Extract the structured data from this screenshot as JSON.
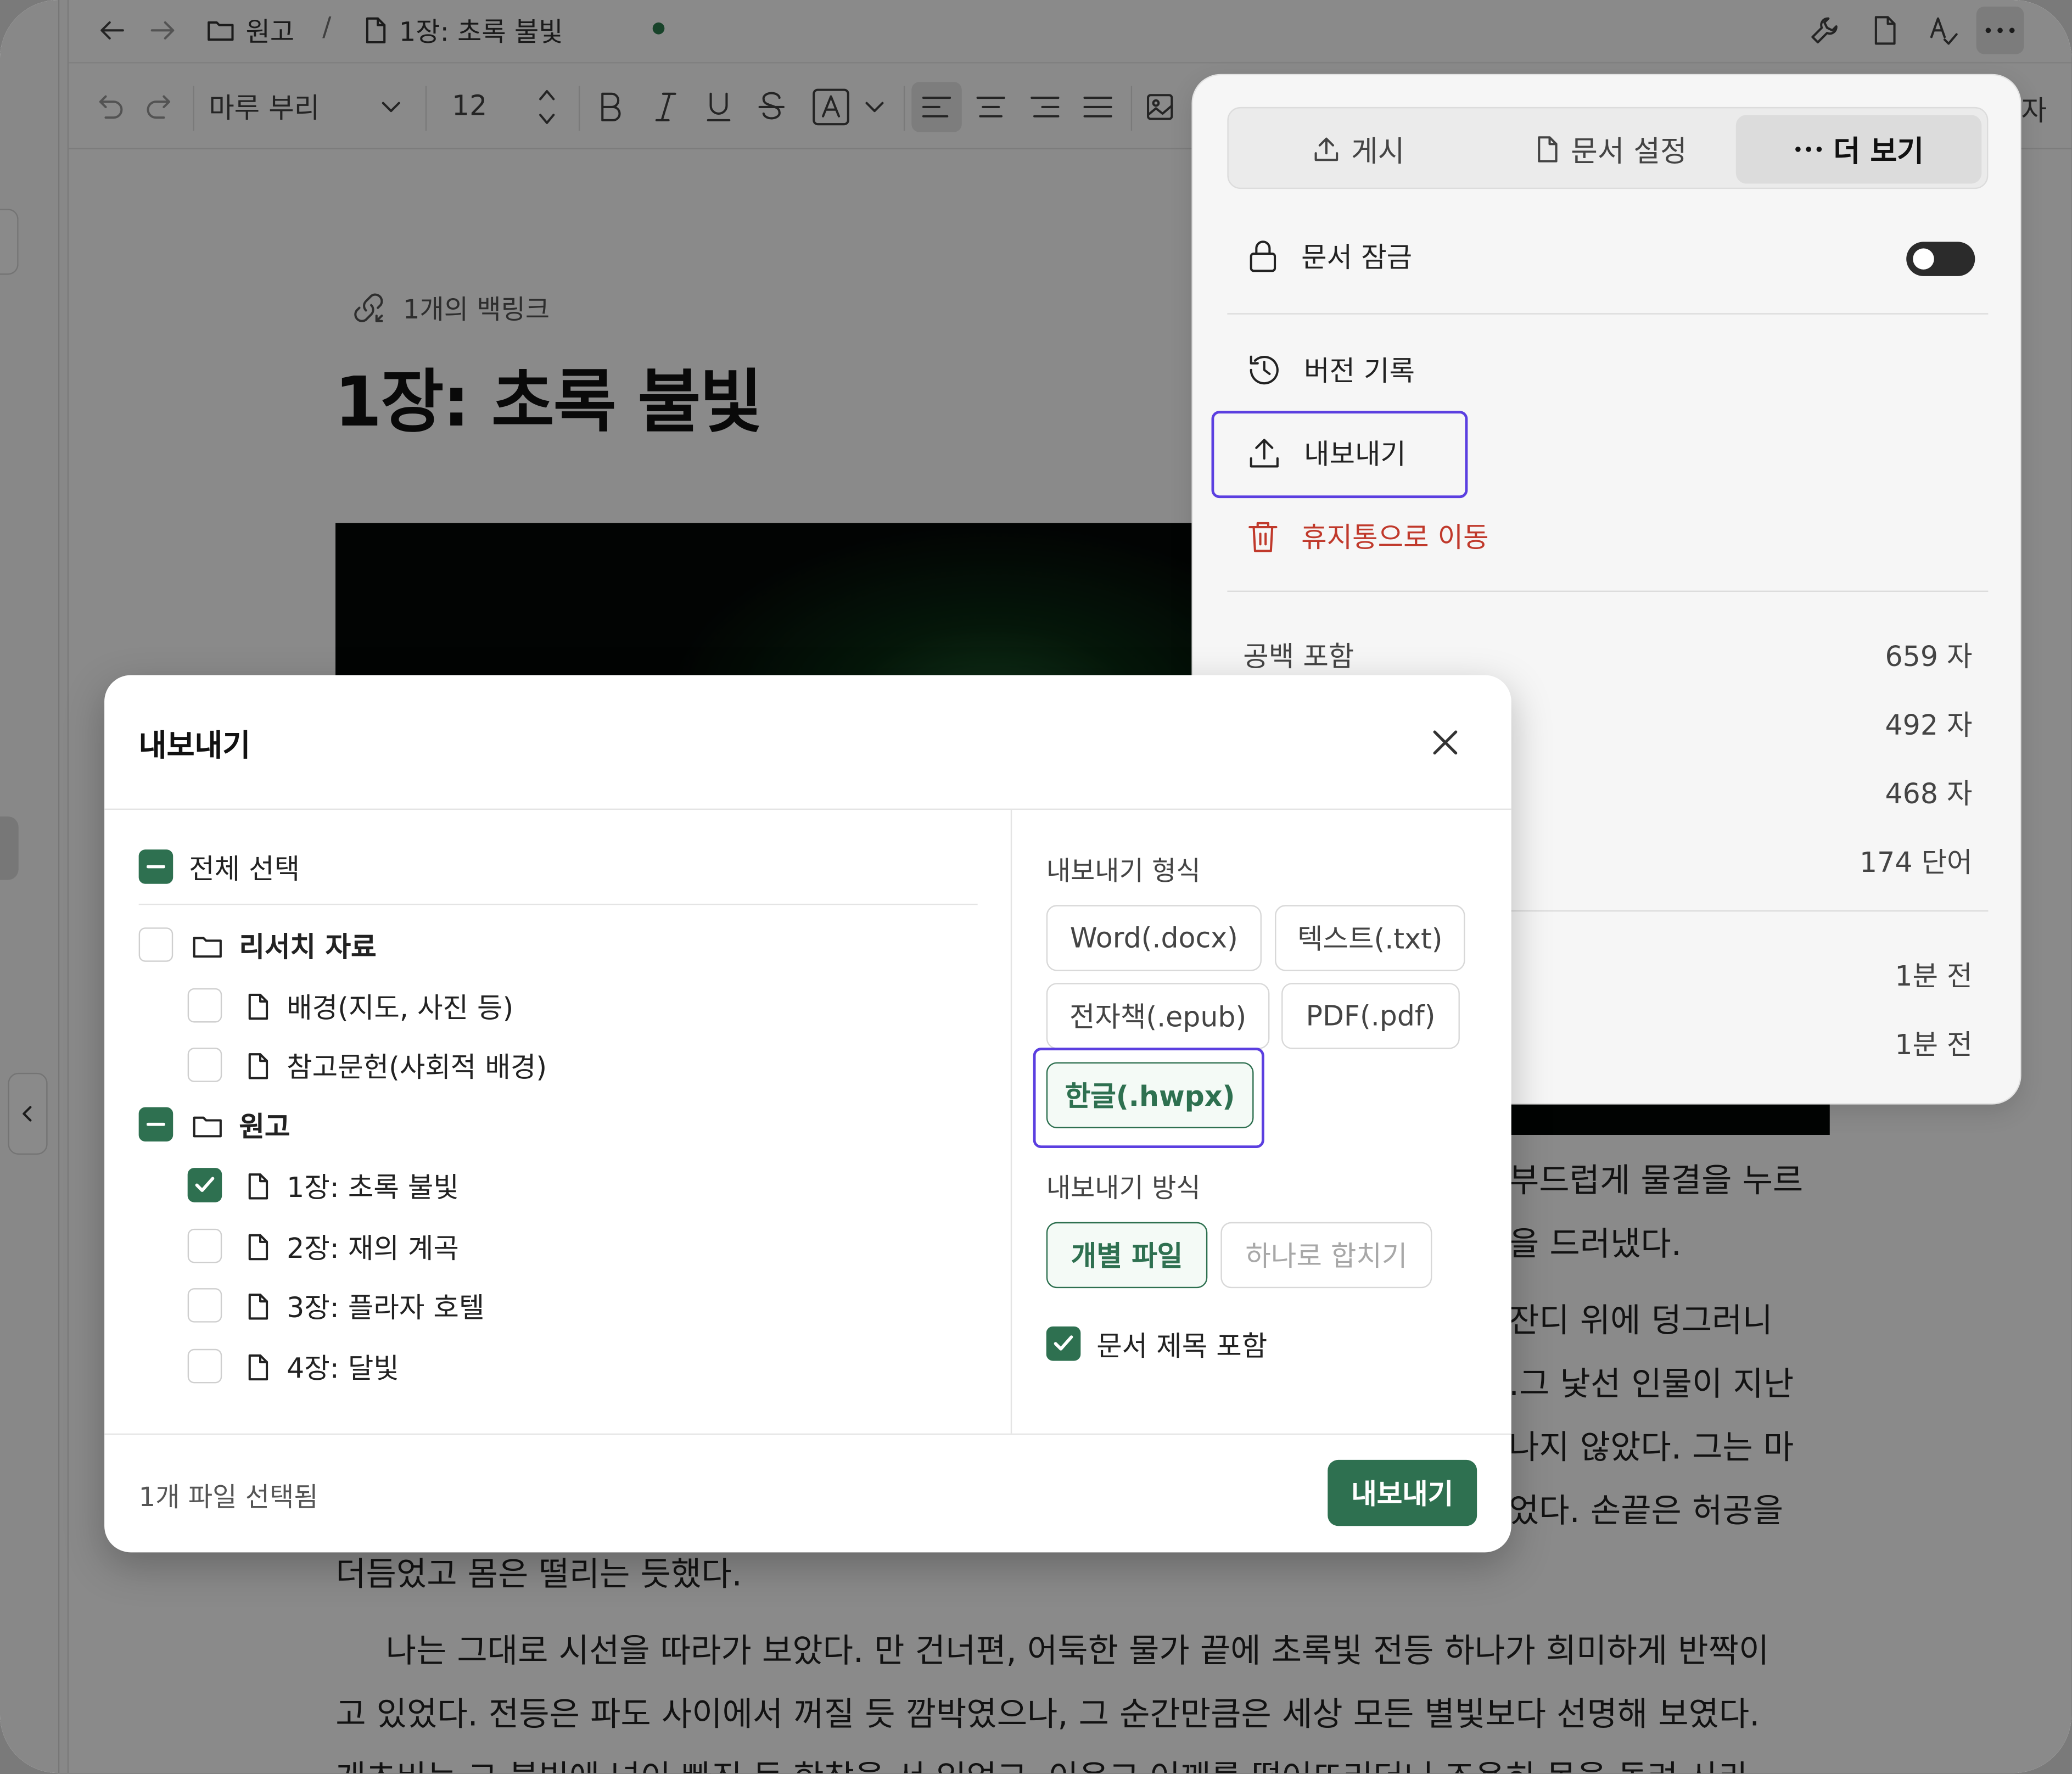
{
  "topbar": {
    "breadcrumb_folder": "원고",
    "separator": "/",
    "doc_name": "1장: 초록 불빛"
  },
  "toolbar": {
    "font_family": "마루 부리",
    "font_size": "12",
    "overflow_label": "자"
  },
  "document": {
    "backlinks": "1개의 백링크",
    "title": "1장: 초록 불빛",
    "paragraphs": [
      "부드럽게 물결을 누르",
      "을 드러냈다.",
      "잔디 위에 덩그러니",
      ".그 낯선 인물이 지난",
      "나지 않았다. 그는 마",
      "었다. 손끝은 허공을",
      "더듬었고 몸은 떨리는 듯했다.",
      "나는 그대로 시선을 따라가 보았다. 만 건너편, 어둑한 물가 끝에 초록빛 전등 하나가 희미하게 반짝이",
      "고 있었다. 전등은 파도 사이에서 꺼질 듯 깜박였으나, 그 순간만큼은 세상 모든 별빛보다 선명해 보였다.",
      "개츠비는 그 불빛에 넋이 빠진 듯 한참을 서 있었고, 이윽고 어깨를 떨어뜨리더니 조용히 몸을 돌려 사라"
    ]
  },
  "more_panel": {
    "tabs": [
      "게시",
      "문서 설정",
      "더 보기"
    ],
    "active_tab": "더 보기",
    "lock_label": "문서 잠금",
    "lock_on": false,
    "history_label": "버전 기록",
    "export_label": "내보내기",
    "trash_label": "휴지통으로 이동",
    "stats": [
      {
        "label": "공백 포함",
        "value": "659 자"
      },
      {
        "label": "",
        "value": "492 자"
      },
      {
        "label": "",
        "value": "468 자"
      },
      {
        "label": "",
        "value": "174 단어"
      }
    ],
    "times": [
      "1분 전",
      "1분 전"
    ],
    "danger_color": "#c0392b"
  },
  "export_dialog": {
    "title": "내보내기",
    "select_all": "전체 선택",
    "tree": [
      {
        "type": "folder",
        "label": "리서치 자료",
        "state": "unchecked",
        "bold": true
      },
      {
        "type": "file",
        "label": "배경(지도, 사진 등)",
        "state": "unchecked"
      },
      {
        "type": "file",
        "label": "참고문헌(사회적 배경)",
        "state": "unchecked"
      },
      {
        "type": "folder",
        "label": "원고",
        "state": "partial",
        "bold": true
      },
      {
        "type": "file",
        "label": "1장: 초록 불빛",
        "state": "checked"
      },
      {
        "type": "file",
        "label": "2장: 재의 계곡",
        "state": "unchecked"
      },
      {
        "type": "file",
        "label": "3장: 플라자 호텔",
        "state": "unchecked"
      },
      {
        "type": "file",
        "label": "4장: 달빛",
        "state": "unchecked"
      }
    ],
    "format_label": "내보내기 형식",
    "formats": [
      "Word(.docx)",
      "텍스트(.txt)",
      "전자책(.epub)",
      "PDF(.pdf)",
      "한글(.hwpx)"
    ],
    "selected_format": "한글(.hwpx)",
    "method_label": "내보내기 방식",
    "methods": [
      "개별 파일",
      "하나로 합치기"
    ],
    "selected_method": "개별 파일",
    "include_title_label": "문서 제목 포함",
    "include_title_checked": true,
    "status": "1개 파일 선택됨",
    "submit": "내보내기",
    "accent_color": "#2e7050",
    "highlight_color": "#5b3fe0"
  }
}
